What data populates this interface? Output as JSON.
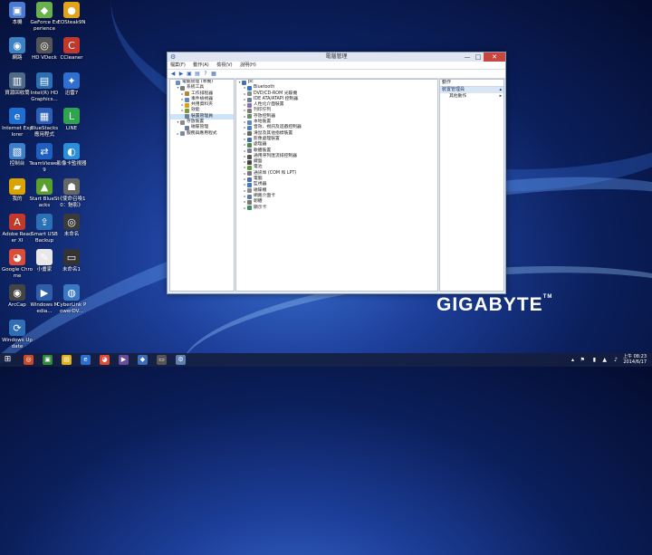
{
  "desktop_icons": [
    {
      "label": "本機",
      "color": "#4a7bd0",
      "glyph": "▣",
      "icon": "computer-icon"
    },
    {
      "label": "GeForce Experience",
      "color": "#6ab04c",
      "glyph": "◆",
      "icon": "nvidia-icon"
    },
    {
      "label": "EOSteak9N",
      "color": "#e0a31a",
      "glyph": "●",
      "icon": "app-icon"
    },
    {
      "label": "網路",
      "color": "#3b82c4",
      "glyph": "◉",
      "icon": "network-icon"
    },
    {
      "label": "HD VDeck",
      "color": "#555555",
      "glyph": "◎",
      "icon": "dvd-icon"
    },
    {
      "label": "CCleaner",
      "color": "#c0392b",
      "glyph": "C",
      "icon": "ccleaner-icon"
    },
    {
      "label": "資源回收筒",
      "color": "#4f6a88",
      "glyph": "▥",
      "icon": "recycle-bin-icon"
    },
    {
      "label": "Intel(R) HD Graphics...",
      "color": "#2c6fb3",
      "glyph": "▤",
      "icon": "intel-graphics-icon"
    },
    {
      "label": "迅雷7",
      "color": "#2f6fcf",
      "glyph": "✦",
      "icon": "thunder-icon"
    },
    {
      "label": "Internet Explorer",
      "color": "#1f6fd0",
      "glyph": "e",
      "icon": "ie-icon"
    },
    {
      "label": "BlueStacks 應用程式",
      "color": "#2b5fb8",
      "glyph": "▦",
      "icon": "bluestacks-apps-icon"
    },
    {
      "label": "LINE",
      "color": "#2ea44f",
      "glyph": "L",
      "icon": "line-icon"
    },
    {
      "label": "控制台",
      "color": "#3d7fc9",
      "glyph": "▧",
      "icon": "control-panel-icon"
    },
    {
      "label": "TeamViewer 9",
      "color": "#1f5fbf",
      "glyph": "⇄",
      "icon": "teamviewer-icon"
    },
    {
      "label": "影像卡監視器",
      "color": "#2a8ed9",
      "glyph": "◐",
      "icon": "monitor-icon"
    },
    {
      "label": "我的",
      "color": "#d9a400",
      "glyph": "▰",
      "icon": "folder-icon"
    },
    {
      "label": "Start BlueStacks",
      "color": "#5aa02c",
      "glyph": "▲",
      "icon": "bluestacks-icon"
    },
    {
      "label": "《使命召喚10：魅影》",
      "color": "#666666",
      "glyph": "☗",
      "icon": "game-icon"
    },
    {
      "label": "Adobe Reader XI",
      "color": "#c0392b",
      "glyph": "A",
      "icon": "adobe-reader-icon"
    },
    {
      "label": "Smart USB Backup",
      "color": "#2b6fb5",
      "glyph": "⇪",
      "icon": "usb-backup-icon"
    },
    {
      "label": "未命名",
      "color": "#3a3a3a",
      "glyph": "◎",
      "icon": "shortcut-icon"
    },
    {
      "label": "Google Chrome",
      "color": "#dd4b39",
      "glyph": "◕",
      "icon": "chrome-icon"
    },
    {
      "label": "小畫家",
      "color": "#e8e8e8",
      "glyph": "✎",
      "icon": "paint-icon"
    },
    {
      "label": "未命名1",
      "color": "#333333",
      "glyph": "▭",
      "icon": "video-icon"
    },
    {
      "label": "ArcCap",
      "color": "#444444",
      "glyph": "◉",
      "icon": "arccap-icon"
    },
    {
      "label": "Windows Media...",
      "color": "#2f5fa8",
      "glyph": "▶",
      "icon": "media-icon"
    },
    {
      "label": "CyberLink PowerDV...",
      "color": "#3a78c4",
      "glyph": "◍",
      "icon": "powerdvd-icon"
    },
    {
      "label": "Windows Update",
      "color": "#2f6db5",
      "glyph": "⟳",
      "icon": "windows-update-icon"
    }
  ],
  "window": {
    "title": "電腦管理",
    "menu": [
      "檔案(F)",
      "動作(A)",
      "檢視(V)",
      "說明(H)"
    ],
    "minimize": "—",
    "maximize": "□",
    "close": "✕"
  },
  "left_tree": [
    {
      "label": "電腦管理 (本機)",
      "indent": 0,
      "tri": "",
      "color": "#6b8fc2"
    },
    {
      "label": "系統工具",
      "indent": 1,
      "tri": "▾",
      "color": "#7a7a7a"
    },
    {
      "label": "工作排程器",
      "indent": 2,
      "tri": "▸",
      "color": "#b8862e"
    },
    {
      "label": "事件檢視器",
      "indent": 2,
      "tri": "▸",
      "color": "#5f87bd"
    },
    {
      "label": "共用資料夾",
      "indent": 2,
      "tri": "▸",
      "color": "#d9a400"
    },
    {
      "label": "效能",
      "indent": 2,
      "tri": "▸",
      "color": "#7d9a3b"
    },
    {
      "label": "裝置管理員",
      "indent": 2,
      "tri": "",
      "color": "#6f7f98",
      "selected": true
    },
    {
      "label": "存放裝置",
      "indent": 1,
      "tri": "▾",
      "color": "#8a8a8a"
    },
    {
      "label": "磁碟管理",
      "indent": 2,
      "tri": "",
      "color": "#6a7d9a"
    },
    {
      "label": "服務與應用程式",
      "indent": 1,
      "tri": "▸",
      "color": "#7a8aa6"
    }
  ],
  "device_tree": {
    "root": "pc",
    "items": [
      {
        "label": "Bluetooth",
        "color": "#2b73d6"
      },
      {
        "label": "DVD/CD-ROM 光碟機",
        "color": "#8a8a8a"
      },
      {
        "label": "IDE ATA/ATAPI 控制器",
        "color": "#6a7d9a"
      },
      {
        "label": "人性化介面裝置",
        "color": "#8a6bb8"
      },
      {
        "label": "列印佇列",
        "color": "#7a7a7a"
      },
      {
        "label": "存放控制器",
        "color": "#6b8a6b"
      },
      {
        "label": "本地裝置",
        "color": "#5a86c4"
      },
      {
        "label": "音效、視訊及遊戲控制器",
        "color": "#4a7fc0"
      },
      {
        "label": "滑鼠及其他指標裝置",
        "color": "#666666"
      },
      {
        "label": "影像處理裝置",
        "color": "#3f6fa8"
      },
      {
        "label": "處理器",
        "color": "#4a8a4a"
      },
      {
        "label": "軟體裝置",
        "color": "#7a7a9a"
      },
      {
        "label": "通用序列匯流排控制器",
        "color": "#555555"
      },
      {
        "label": "鍵盤",
        "color": "#444444"
      },
      {
        "label": "電池",
        "color": "#5b9a3b"
      },
      {
        "label": "通訊埠 (COM 和 LPT)",
        "color": "#777777"
      },
      {
        "label": "電腦",
        "color": "#4a6fb0"
      },
      {
        "label": "監視器",
        "color": "#3d78c8"
      },
      {
        "label": "磁碟機",
        "color": "#8a8a8a"
      },
      {
        "label": "網路介面卡",
        "color": "#5a7ab0"
      },
      {
        "label": "韌體",
        "color": "#777777"
      },
      {
        "label": "顯示卡",
        "color": "#3a8f5a"
      }
    ]
  },
  "actions": {
    "header": "動作",
    "group": "裝置管理員",
    "item": "其他動作",
    "group_arrow": "▴",
    "item_arrow": "▸"
  },
  "brand": {
    "text": "GIGABYTE",
    "mark": "TM"
  },
  "taskbar": {
    "apps": [
      {
        "color": "#c74a2a",
        "glyph": "◎",
        "name": "taskbar-app-1"
      },
      {
        "color": "#2f8a3c",
        "glyph": "▣",
        "name": "taskbar-app-2"
      },
      {
        "color": "#e1b11c",
        "glyph": "▤",
        "name": "taskbar-file-explorer"
      },
      {
        "color": "#2a6fd0",
        "glyph": "e",
        "name": "taskbar-ie"
      },
      {
        "color": "#dd4b39",
        "glyph": "◕",
        "name": "taskbar-chrome"
      },
      {
        "color": "#6a4c9a",
        "glyph": "▶",
        "name": "taskbar-media"
      },
      {
        "color": "#3a6fb8",
        "glyph": "◆",
        "name": "taskbar-app-7"
      },
      {
        "color": "#555555",
        "glyph": "▭",
        "name": "taskbar-app-8"
      },
      {
        "color": "#5f7fb0",
        "glyph": "⚙",
        "name": "taskbar-computer-management"
      }
    ],
    "time": "上午 08:23",
    "date": "2014/6/17"
  }
}
